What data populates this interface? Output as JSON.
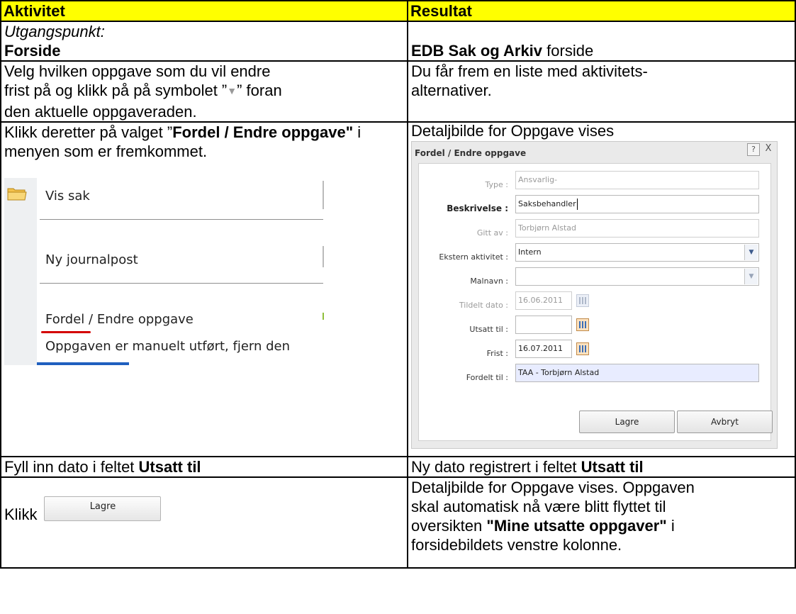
{
  "headers": {
    "activity": "Aktivitet",
    "result": "Resultat"
  },
  "rows": {
    "r1": {
      "start_label": "Utgangspunkt:",
      "start_value": "Forside",
      "result_bold": "EDB Sak og Arkiv",
      "result_rest": " forside"
    },
    "r2": {
      "activity_line1": "Velg hvilken oppgave som du vil endre",
      "activity_line2a": "frist på og klikk på på symbolet ”",
      "activity_line2b": "” foran",
      "activity_line3": "den aktuelle oppgaveraden.",
      "result_line1": "Du får frem en liste med aktivitets-",
      "result_line2": "alternativer."
    },
    "r3": {
      "activity_pre": "Klikk deretter på valget ”",
      "activity_bold": "Fordel / Endre oppgave\"",
      "activity_post": " i menyen som er fremkommet.",
      "result": "Detaljbilde for Oppgave vises"
    },
    "r4": {
      "activity_pre": "Fyll inn dato i feltet ",
      "activity_bold": "Utsatt til",
      "result_pre": "Ny dato registrert i feltet ",
      "result_bold": "Utsatt til"
    },
    "r5": {
      "activity_pre": "Klikk",
      "result_line1": "Detaljbilde for Oppgave vises. Oppgaven",
      "result_line2": "skal automatisk nå være blitt flyttet til",
      "result_line3_pre": "oversikten ",
      "result_line3_bold": "\"Mine utsatte oppgaver\"",
      "result_line3_post": " i",
      "result_line4": "forsidebildets venstre kolonne."
    }
  },
  "dropdown_symbol": "▼",
  "context_menu": {
    "items": [
      "Vis sak",
      "Ny journalpost",
      "Fordel / Endre oppgave",
      "Oppgaven er manuelt utført, fjern den"
    ],
    "highlight_color": "#d40000"
  },
  "dialog": {
    "title": "Fordel / Endre oppgave",
    "help_label": "?",
    "close_label": "X",
    "fields": {
      "type_label": "Type :",
      "type_value": "Ansvarlig-",
      "beskrivelse_label": "Beskrivelse :",
      "beskrivelse_value": "Saksbehandler",
      "gitt_label": "Gitt av :",
      "gitt_value": "Torbjørn Alstad",
      "ekstern_label": "Ekstern aktivitet :",
      "ekstern_value": "Intern",
      "malnavn_label": "Malnavn :",
      "malnavn_value": "",
      "tildelt_label": "Tildelt dato :",
      "tildelt_value": "16.06.2011",
      "utsatt_label": "Utsatt til :",
      "utsatt_value": "",
      "frist_label": "Frist :",
      "frist_value": "16.07.2011",
      "fordelt_label": "Fordelt til :",
      "fordelt_value": "TAA - Torbjørn Alstad"
    },
    "save_label": "Lagre",
    "cancel_label": "Avbryt"
  },
  "inline_button": {
    "label": "Lagre"
  },
  "colors": {
    "header_bg": "#ffff00",
    "border": "#000000"
  }
}
